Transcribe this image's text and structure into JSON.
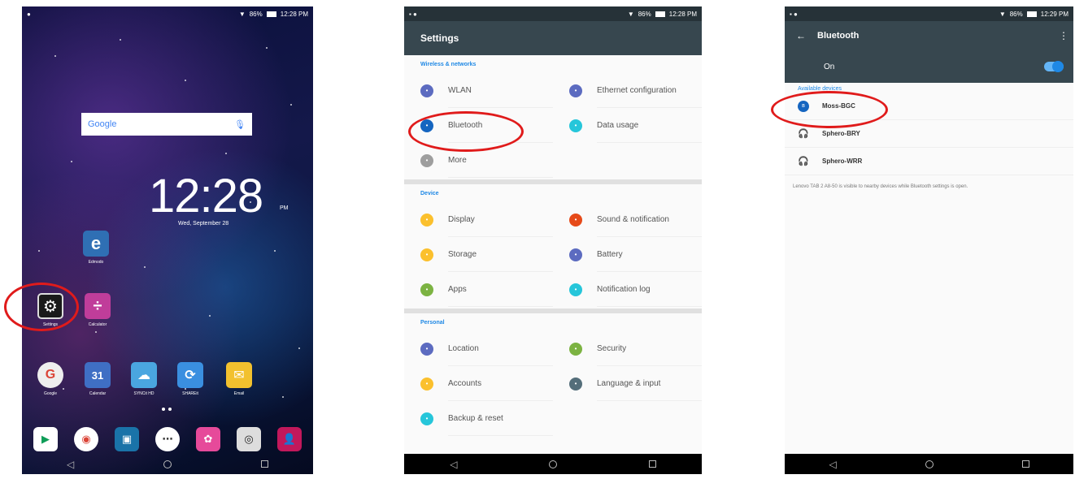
{
  "status": {
    "time_home": "12:28 PM",
    "time_settings": "12:28 PM",
    "time_bt": "12:29 PM",
    "battery": "86%"
  },
  "home": {
    "search_placeholder": "Google",
    "clock": "12:28",
    "clock_ampm": "PM",
    "date": "Wed, September 28",
    "apps": [
      {
        "label": "Edmodo",
        "icon": "edmodo-icon",
        "color": "#2f6fb4"
      },
      {
        "label": "Settings",
        "icon": "settings-gear-icon",
        "color": "#1a1a1a"
      },
      {
        "label": "Calculator",
        "icon": "calculator-icon",
        "color": "#c03d9a"
      },
      {
        "label": "Google",
        "icon": "google-icon",
        "color": "#ffffff"
      },
      {
        "label": "Calendar",
        "icon": "calendar-icon",
        "color": "#3f6fc4"
      },
      {
        "label": "SYNCit HD",
        "icon": "syncit-icon",
        "color": "#4aa6e0"
      },
      {
        "label": "SHAREit",
        "icon": "shareit-icon",
        "color": "#3a8fe0"
      },
      {
        "label": "Email",
        "icon": "email-icon",
        "color": "#f2c12e"
      }
    ],
    "dock": [
      "play-store-icon",
      "chrome-icon",
      "media-icon",
      "app-drawer-icon",
      "photos-icon",
      "camera-icon",
      "contacts-icon"
    ]
  },
  "settings": {
    "title": "Settings",
    "sections": [
      {
        "header": "Wireless & networks",
        "rows": [
          [
            {
              "label": "WLAN",
              "color": "#5c6bc0",
              "icon": "wifi-icon"
            },
            {
              "label": "Ethernet configuration",
              "color": "#5c6bc0",
              "icon": "ethernet-icon"
            }
          ],
          [
            {
              "label": "Bluetooth",
              "color": "#1565c0",
              "icon": "bluetooth-icon"
            },
            {
              "label": "Data usage",
              "color": "#26c6da",
              "icon": "data-usage-icon"
            }
          ],
          [
            {
              "label": "More",
              "color": "#9e9e9e",
              "icon": "more-icon"
            },
            null
          ]
        ]
      },
      {
        "header": "Device",
        "rows": [
          [
            {
              "label": "Display",
              "color": "#fbc02d",
              "icon": "display-icon"
            },
            {
              "label": "Sound & notification",
              "color": "#e64a19",
              "icon": "sound-icon"
            }
          ],
          [
            {
              "label": "Storage",
              "color": "#fbc02d",
              "icon": "storage-icon"
            },
            {
              "label": "Battery",
              "color": "#5c6bc0",
              "icon": "battery-icon"
            }
          ],
          [
            {
              "label": "Apps",
              "color": "#7cb342",
              "icon": "apps-icon"
            },
            {
              "label": "Notification log",
              "color": "#26c6da",
              "icon": "notification-log-icon"
            }
          ]
        ]
      },
      {
        "header": "Personal",
        "rows": [
          [
            {
              "label": "Location",
              "color": "#5c6bc0",
              "icon": "location-icon"
            },
            {
              "label": "Security",
              "color": "#7cb342",
              "icon": "security-icon"
            }
          ],
          [
            {
              "label": "Accounts",
              "color": "#fbc02d",
              "icon": "accounts-icon"
            },
            {
              "label": "Language & input",
              "color": "#546e7a",
              "icon": "language-icon"
            }
          ],
          [
            {
              "label": "Backup & reset",
              "color": "#26c6da",
              "icon": "backup-icon"
            },
            null
          ]
        ]
      }
    ]
  },
  "bluetooth": {
    "title": "Bluetooth",
    "toggle_label": "On",
    "available_header": "Available devices",
    "devices": [
      {
        "name": "Moss-BGC",
        "icon": "bluetooth-device-icon"
      },
      {
        "name": "Sphero-BRY",
        "icon": "headset-icon"
      },
      {
        "name": "Sphero-WRR",
        "icon": "headset-icon"
      }
    ],
    "visibility_note": "Lenovo TAB 2 A8-50 is visible to nearby devices while Bluetooth settings is open."
  },
  "accent": "#e01b1b"
}
